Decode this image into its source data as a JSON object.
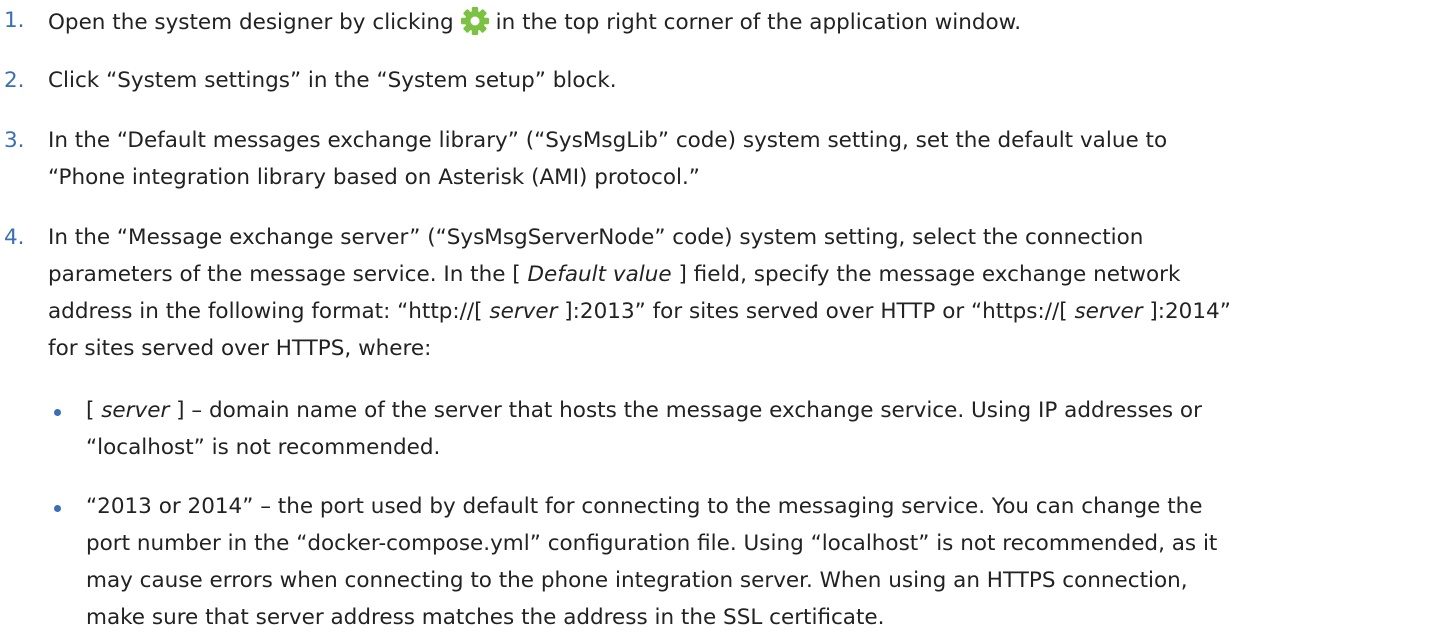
{
  "steps": [
    {
      "number": "1.",
      "text_before_icon": "Open the system designer by clicking",
      "icon": "gear-icon",
      "text_after_icon": "in the top right corner of the application window."
    },
    {
      "number": "2.",
      "text": "Click “System settings” in the “System setup” block."
    },
    {
      "number": "3.",
      "lines": [
        "In the “Default messages exchange library” (“SysMsgLib” code) system setting, set the default value to",
        "“Phone integration library based on Asterisk (AMI) protocol.”"
      ]
    },
    {
      "number": "4.",
      "line1": "In the “Message exchange server” (“SysMsgServerNode” code) system setting, select the connection",
      "line2_a": "parameters of the message service. In the [ ",
      "line2_em": "Default value",
      "line2_b": " ] field, specify the message exchange network",
      "line3_a": "address in the following format: “http://[ ",
      "line3_em1": "server",
      "line3_b": " ]:2013” for sites served over HTTP or “https://[ ",
      "line3_em2": "server",
      "line3_c": " ]:2014”",
      "line4": "for sites served over HTTPS, where:",
      "bullets": [
        {
          "line1_a": "[ ",
          "line1_em": "server",
          "line1_b": " ] – domain name of the server that hosts the message exchange service. Using IP addresses or",
          "line2": "“localhost” is not recommended."
        },
        {
          "lines": [
            "“2013 or 2014” – the port used by default for connecting to the messaging service. You can change the",
            "port number in the “docker-compose.yml” configuration file. Using “localhost” is not recommended, as it",
            "may cause errors when connecting to the phone integration server. When using an HTTPS connection,",
            "make sure that server address matches the address in the SSL certificate."
          ]
        }
      ]
    }
  ],
  "colors": {
    "text": "#222222",
    "accent": "#3a6fb5",
    "gear": "#7cc242"
  }
}
